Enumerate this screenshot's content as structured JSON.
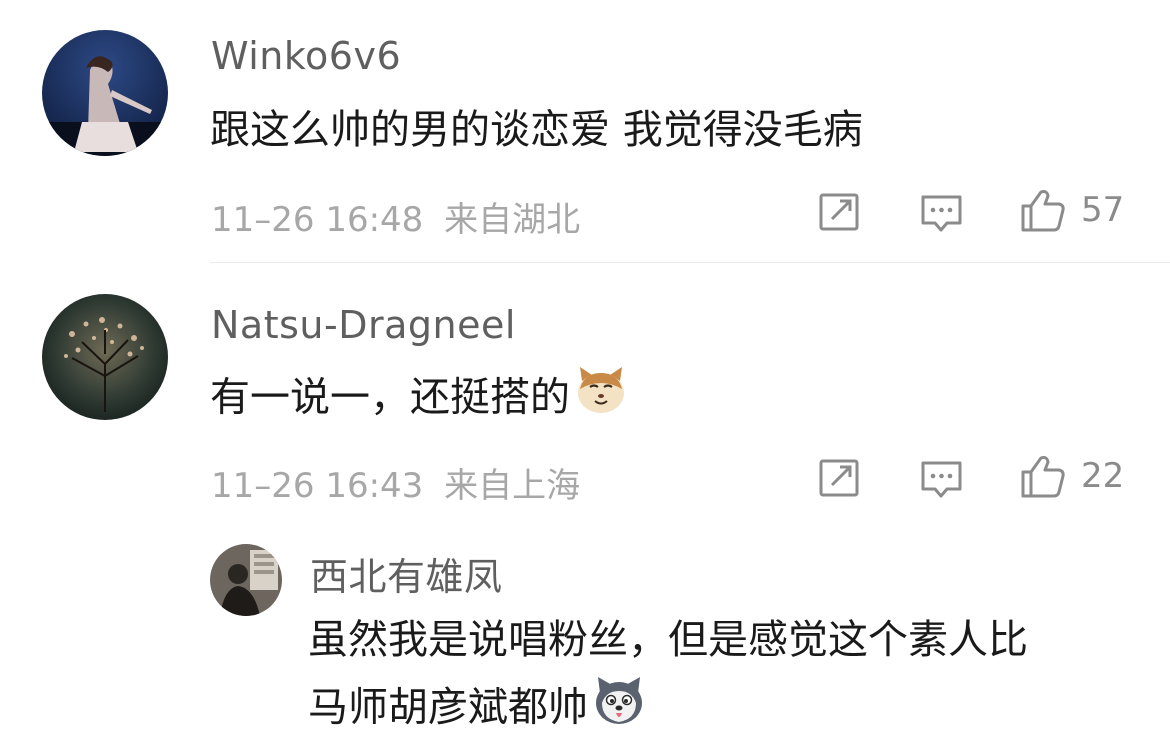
{
  "comments": [
    {
      "username": "Winko6v6",
      "text": "跟这么帅的男的谈恋爱 我觉得没毛病",
      "time": "11–26 16:48",
      "location": "来自湖北",
      "likes": "57"
    },
    {
      "username": "Natsu-Dragneel",
      "text": "有一说一，还挺搭的",
      "time": "11–26 16:43",
      "location": "来自上海",
      "likes": "22",
      "emoji": "cat-face-emoji"
    }
  ],
  "reply": {
    "username": "西北有雄凤",
    "text_line1": "虽然我是说唱粉丝，但是感觉这个素人比",
    "text_line2": "马师胡彦斌都帅",
    "emoji": "husky-emoji"
  },
  "icons": {
    "share": "share-icon",
    "comment": "comment-icon",
    "like": "thumbs-up-icon"
  }
}
